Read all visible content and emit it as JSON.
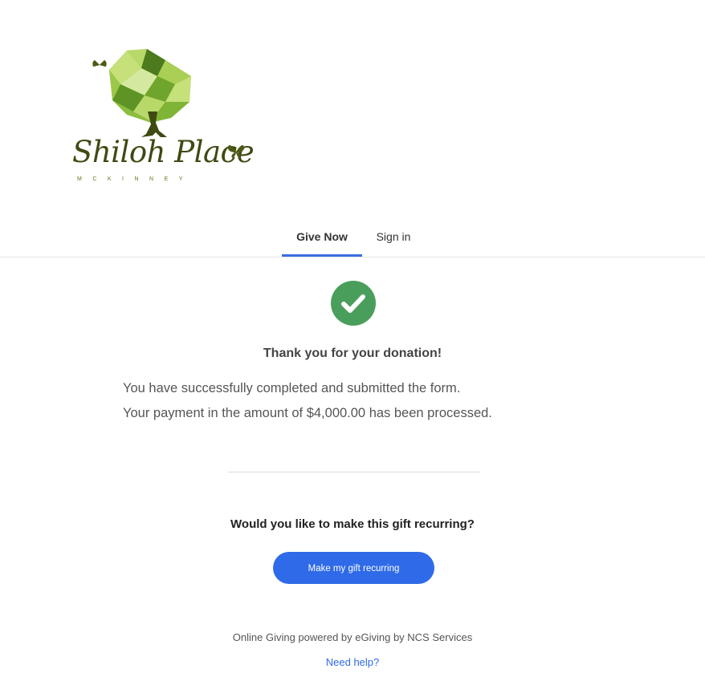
{
  "logo": {
    "name": "Shiloh Place",
    "subtitle": "MCKINNEY",
    "colors": {
      "leaf_light": "#b9d86a",
      "leaf_mid": "#8dbd3e",
      "leaf_dark": "#4c7a1c",
      "trunk": "#3f4a12"
    }
  },
  "tabs": [
    {
      "label": "Give Now",
      "active": true
    },
    {
      "label": "Sign in",
      "active": false
    }
  ],
  "confirmation": {
    "icon": "check-circle-icon",
    "title": "Thank you for your donation!",
    "line1": "You have successfully completed and submitted the form.",
    "line2": "Your payment in the amount of $4,000.00 has been processed."
  },
  "recurring": {
    "question": "Would you like to make this gift recurring?",
    "button_label": "Make my gift recurring"
  },
  "footer": {
    "powered_by": "Online Giving powered by eGiving by NCS Services",
    "help_link": "Need help?"
  },
  "colors": {
    "accent": "#2f6ae8",
    "success": "#4a9e5c"
  }
}
